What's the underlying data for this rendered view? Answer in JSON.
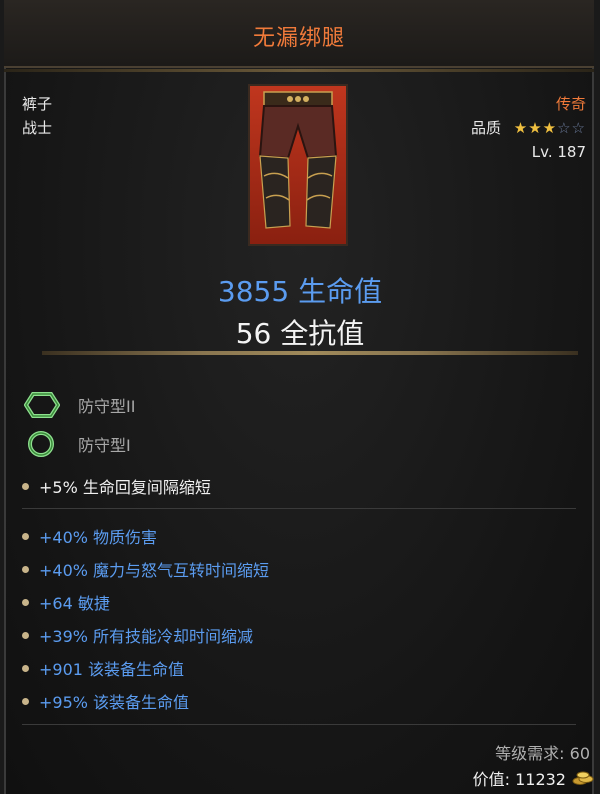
{
  "item": {
    "name": "无漏绑腿",
    "slot": "裤子",
    "class": "战士",
    "rarity": "传奇",
    "quality_label": "品质",
    "quality_stars": 3,
    "quality_max": 5,
    "level": "Lv. 187"
  },
  "main_stats": {
    "primary": "3855 生命值",
    "secondary": "56 全抗值"
  },
  "sockets": [
    {
      "label": "防守型II",
      "icon": "hexagon-gem-icon",
      "color": "#4fbf5f"
    },
    {
      "label": "防守型I",
      "icon": "circle-gem-icon",
      "color": "#4fbf5f"
    }
  ],
  "implicit": [
    "+5% 生命回复间隔缩短"
  ],
  "affixes": [
    "+40% 物质伤害",
    "+40% 魔力与怒气互转时间缩短",
    "+64 敏捷",
    "+39% 所有技能冷却时间缩减",
    "+901 该装备生命值",
    "+95% 该装备生命值"
  ],
  "footer": {
    "requirement": "等级需求: 60",
    "value": "价值: 11232",
    "value_icon": "gold-coins-icon"
  },
  "colors": {
    "title": "#f07a3a",
    "rarity": "#f07a3a",
    "magic_blue": "#5b9cf0",
    "star_gold": "#f0c040",
    "gem_green": "#4fbf5f"
  }
}
